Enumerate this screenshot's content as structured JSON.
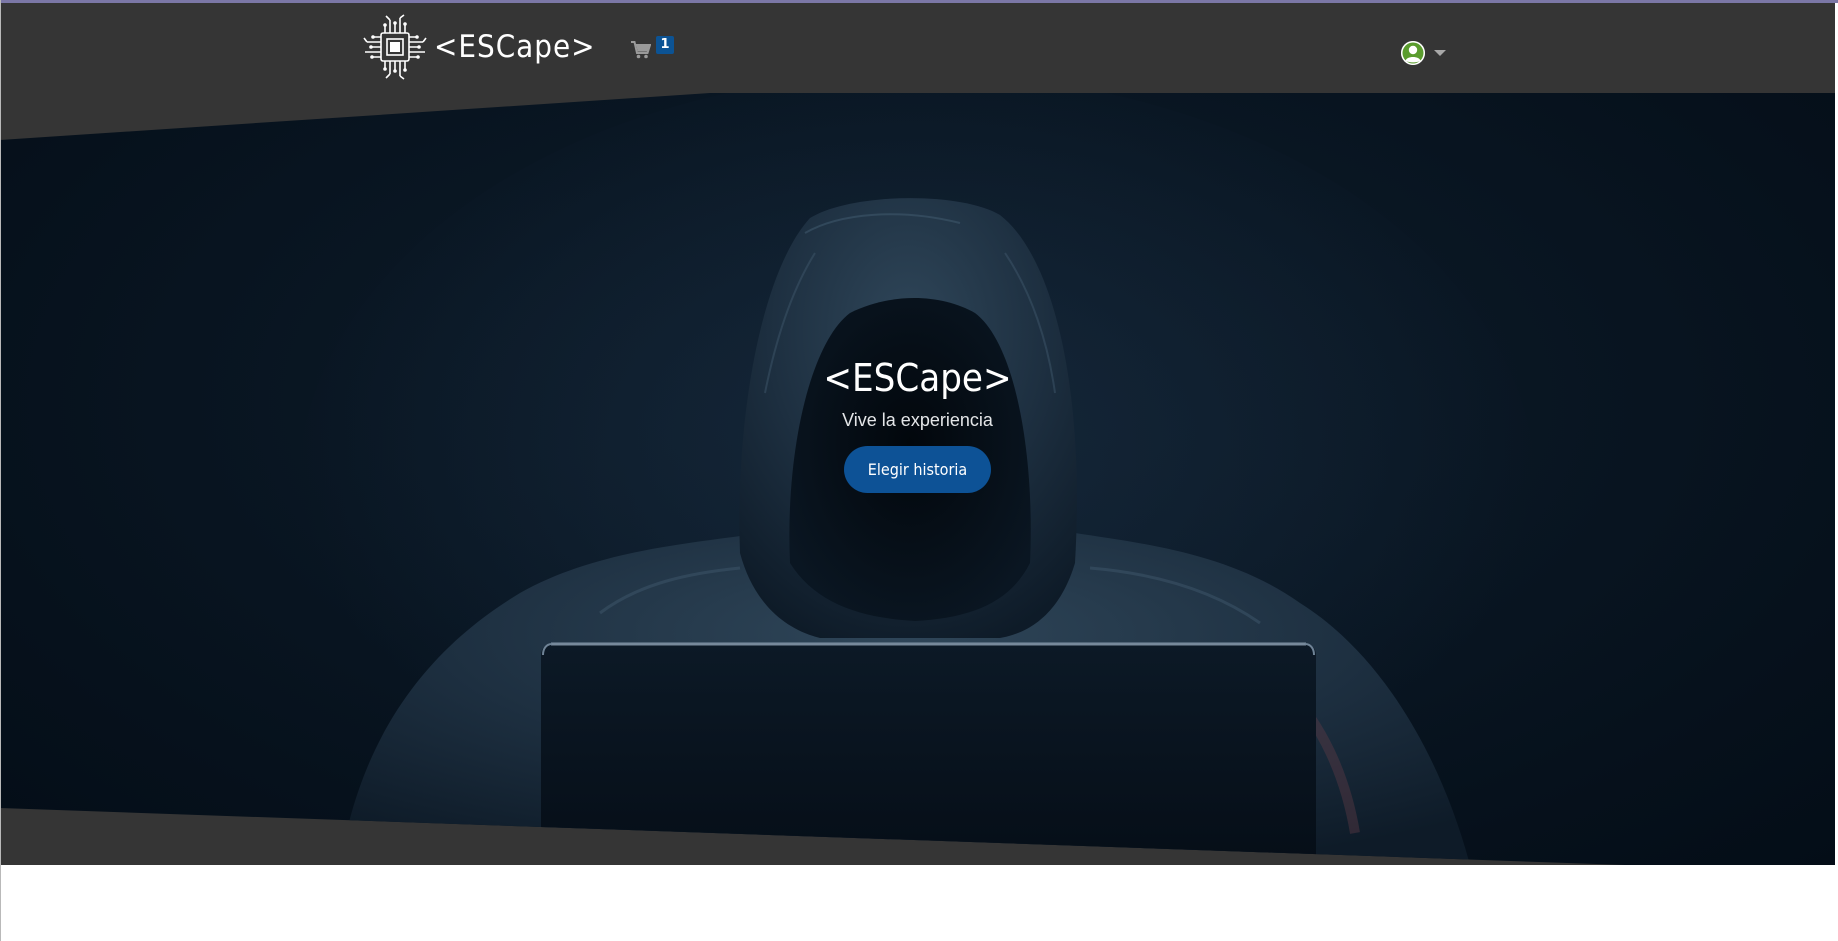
{
  "brand": {
    "logo_text": "<ESCape>",
    "logo_icon": "circuit-chip-icon"
  },
  "navbar": {
    "background": "#353535",
    "cart": {
      "icon": "shopping-cart-icon",
      "badge_count": "1",
      "badge_color": "#0c5394"
    },
    "user_menu": {
      "avatar_icon": "user-avatar-icon",
      "avatar_color": "#5a9c2e",
      "dropdown_icon": "caret-down-icon"
    }
  },
  "hero": {
    "title": "<ESCape>",
    "subtitle": "Vive la experiencia",
    "button_label": "Elegir historia",
    "button_color": "#0d5296",
    "background_image": "hooded-figure-with-laptop"
  },
  "colors": {
    "accent_bar": "#7b77a6",
    "hero_dark": "#06111c"
  }
}
